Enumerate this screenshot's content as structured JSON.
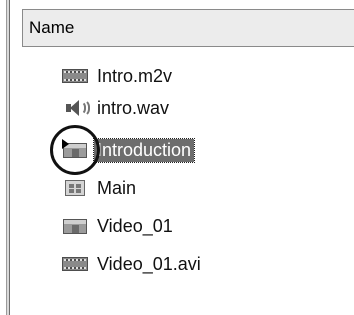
{
  "list": {
    "header_label": "Name",
    "items": [
      {
        "label": "Intro.m2v",
        "icon": "video-file-icon",
        "selected": false
      },
      {
        "label": "intro.wav",
        "icon": "audio-file-icon",
        "selected": false
      },
      {
        "label": "Introduction",
        "icon": "timeline-icon",
        "selected": true
      },
      {
        "label": "Main",
        "icon": "menu-icon",
        "selected": false
      },
      {
        "label": "Video_01",
        "icon": "timeline-icon",
        "selected": false
      },
      {
        "label": "Video_01.avi",
        "icon": "video-file-icon",
        "selected": false
      }
    ]
  },
  "colors": {
    "selection_bg": "#6d6d6d",
    "selection_fg": "#ffffff",
    "header_bg": "#ececec"
  }
}
